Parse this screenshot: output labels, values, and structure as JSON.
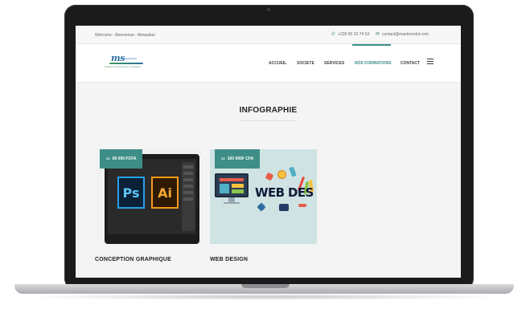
{
  "topbar": {
    "welcome": "Welcome - Bienvenue - Akwaaba!",
    "phone": "+228 90 33 74 53",
    "email": "contact@mastersolut.com",
    "phone_icon": "phone-icon",
    "email_icon": "envelope-icon"
  },
  "logo": {
    "mark": "ms",
    "sub": "MasterSolut",
    "tagline": "Solutions informatiques & Ingénierie"
  },
  "nav": {
    "items": [
      "ACCUEIL",
      "SOCIETE",
      "SERVICES",
      "NOS FORMATIONS",
      "CONTACT"
    ],
    "active": "NOS FORMATIONS",
    "menu_icon": "hamburger-menu-icon"
  },
  "page": {
    "title": "INFOGRAPHIE"
  },
  "cards": [
    {
      "price": "60 000 FCFA",
      "title": "CONCEPTION GRAPHIQUE",
      "image_text": [
        "Ps",
        "Ai"
      ]
    },
    {
      "price": "100 000F CFA",
      "title": "WEB DESIGN",
      "image_text": "WEB DES"
    }
  ],
  "colors": {
    "accent": "#3e8e88",
    "bezel": "#1b1b1c",
    "background": "#f4f4f4"
  }
}
